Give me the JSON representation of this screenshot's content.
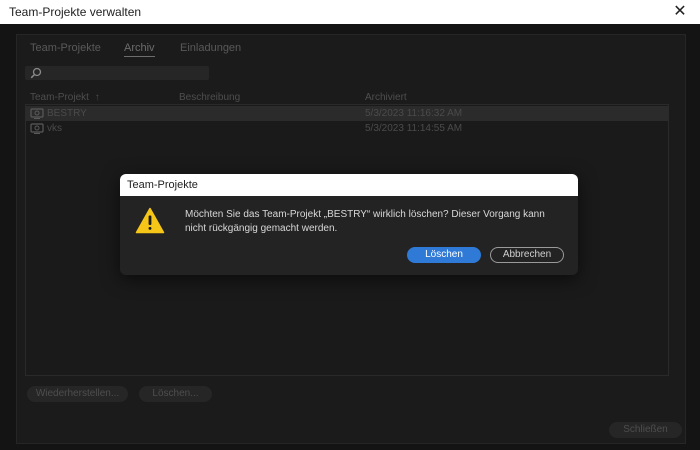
{
  "window": {
    "title": "Team-Projekte verwalten",
    "close_glyph": "✕"
  },
  "tabs": [
    {
      "label": "Team-Projekte",
      "active": false
    },
    {
      "label": "Archiv",
      "active": true
    },
    {
      "label": "Einladungen",
      "active": false
    }
  ],
  "search": {
    "value": "",
    "placeholder": "",
    "icon": "search-icon"
  },
  "table": {
    "columns": [
      "Team-Projekt",
      "Beschreibung",
      "Archiviert"
    ],
    "sort_glyph": "↑",
    "rows": [
      {
        "name": "BESTRY",
        "description": "",
        "archived": "5/3/2023 11:16:32 AM",
        "selected": true,
        "icon": "team-project-icon"
      },
      {
        "name": "vks",
        "description": "",
        "archived": "5/3/2023 11:14:55 AM",
        "selected": false,
        "icon": "team-project-icon"
      }
    ]
  },
  "buttons": {
    "restore": "Wiederherstellen...",
    "delete": "Löschen...",
    "close": "Schließen"
  },
  "modal": {
    "title": "Team-Projekte",
    "message": "Möchten Sie das Team-Projekt „BESTRY“ wirklich löschen? Dieser Vorgang kann nicht rückgängig gemacht werden.",
    "confirm": "Löschen",
    "cancel": "Abbrechen",
    "icon": "warning-icon"
  },
  "colors": {
    "accent": "#2f7ad6",
    "warning": "#f5c518"
  }
}
